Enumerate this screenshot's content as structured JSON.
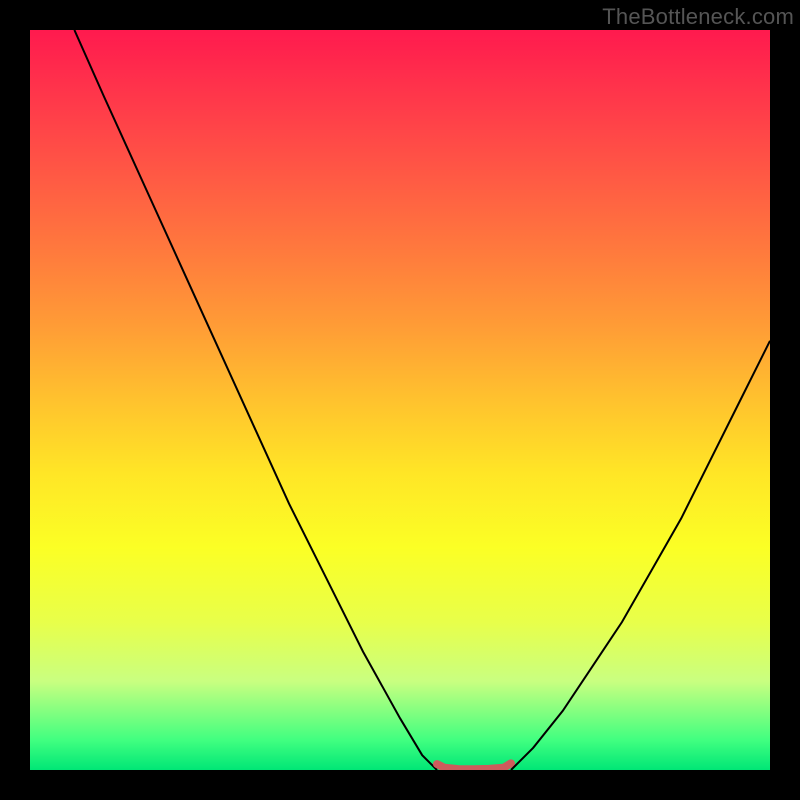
{
  "watermark": "TheBottleneck.com",
  "chart_data": {
    "type": "line",
    "title": "",
    "xlabel": "",
    "ylabel": "",
    "xlim": [
      0,
      100
    ],
    "ylim": [
      0,
      100
    ],
    "grid": false,
    "legend": false,
    "series": [
      {
        "name": "left-curve",
        "stroke": "#000000",
        "x": [
          6,
          10,
          15,
          20,
          25,
          30,
          35,
          40,
          45,
          50,
          53,
          55
        ],
        "y": [
          100,
          91,
          80,
          69,
          58,
          47,
          36,
          26,
          16,
          7,
          2,
          0
        ]
      },
      {
        "name": "optimal-band",
        "stroke": "#cd5c5c",
        "stroke_width": 8,
        "x": [
          55,
          56,
          58,
          60,
          62,
          64,
          65
        ],
        "y": [
          0.8,
          0.3,
          0.1,
          0.1,
          0.15,
          0.3,
          0.9
        ]
      },
      {
        "name": "right-curve",
        "stroke": "#000000",
        "x": [
          65,
          68,
          72,
          76,
          80,
          84,
          88,
          92,
          96,
          100
        ],
        "y": [
          0,
          3,
          8,
          14,
          20,
          27,
          34,
          42,
          50,
          58
        ]
      }
    ]
  }
}
